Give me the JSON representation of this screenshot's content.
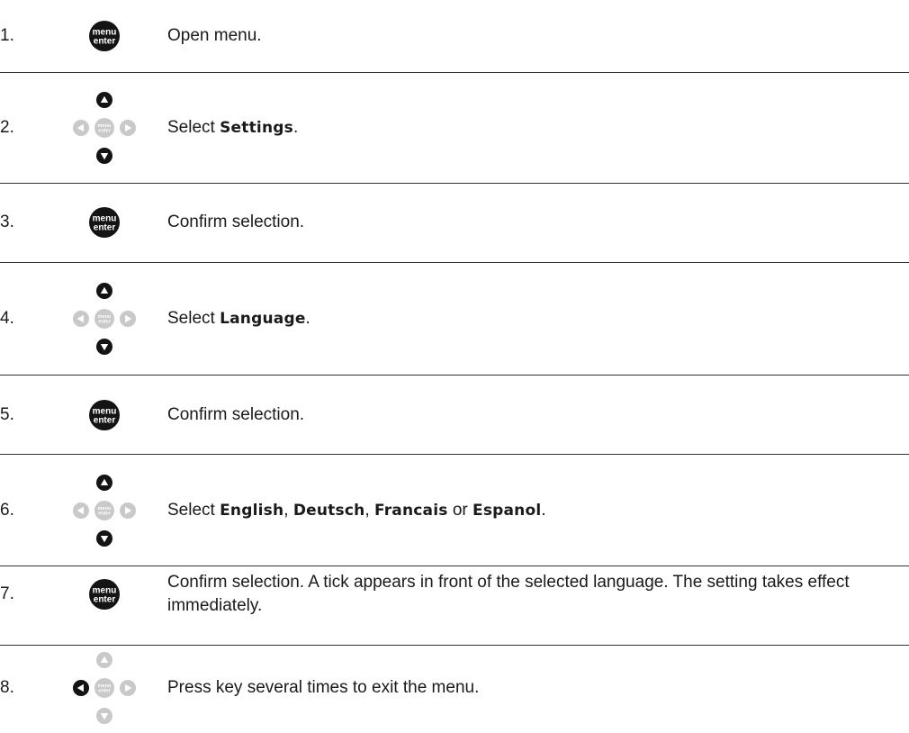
{
  "icon_text": {
    "line1": "menu",
    "line2": "enter"
  },
  "colors": {
    "key_dark": "#141414",
    "key_grey": "#c9c9c9",
    "text": "#1a1a1a",
    "rule": "#333333"
  },
  "steps": [
    {
      "number": "1.",
      "icon": "menu-enter-key-icon",
      "parts": [
        {
          "t": "Open menu."
        }
      ]
    },
    {
      "number": "2.",
      "icon": "navigation-pad-up-down-icon",
      "parts": [
        {
          "t": "Select "
        },
        {
          "t": "Settings",
          "em": true
        },
        {
          "t": "."
        }
      ]
    },
    {
      "number": "3.",
      "icon": "menu-enter-key-icon",
      "parts": [
        {
          "t": "Confirm selection."
        }
      ]
    },
    {
      "number": "4.",
      "icon": "navigation-pad-up-down-icon",
      "parts": [
        {
          "t": "Select "
        },
        {
          "t": "Language",
          "em": true
        },
        {
          "t": "."
        }
      ]
    },
    {
      "number": "5.",
      "icon": "menu-enter-key-icon",
      "parts": [
        {
          "t": "Confirm selection."
        }
      ]
    },
    {
      "number": "6.",
      "icon": "navigation-pad-up-down-icon",
      "parts": [
        {
          "t": "Select "
        },
        {
          "t": "English",
          "em": true
        },
        {
          "t": ", "
        },
        {
          "t": "Deutsch",
          "em": true
        },
        {
          "t": ", "
        },
        {
          "t": "Francais",
          "em": true
        },
        {
          "t": " or "
        },
        {
          "t": "Espanol",
          "em": true
        },
        {
          "t": "."
        }
      ]
    },
    {
      "number": "7.",
      "icon": "menu-enter-key-icon",
      "parts": [
        {
          "t": "Confirm selection. A tick appears in front of the selected language. The setting takes effect immediately."
        }
      ]
    },
    {
      "number": "8.",
      "icon": "navigation-pad-left-icon",
      "parts": [
        {
          "t": "Press key several times to exit the menu."
        }
      ]
    }
  ]
}
